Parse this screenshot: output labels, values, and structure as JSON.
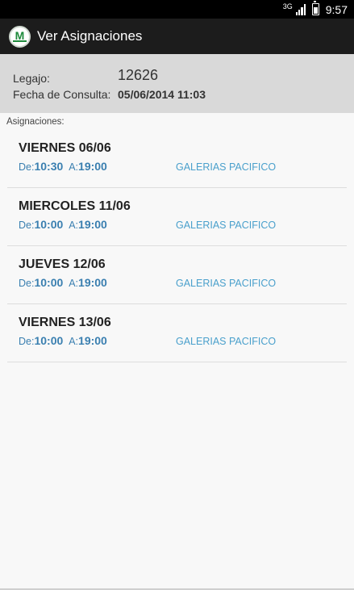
{
  "status_bar": {
    "network": "3G",
    "time": "9:57"
  },
  "action_bar": {
    "title": "Ver Asignaciones"
  },
  "header": {
    "legajo_label": "Legajo:",
    "legajo_value": "12626",
    "fecha_label": "Fecha de Consulta:",
    "fecha_value": "05/06/2014 11:03"
  },
  "section_label": "Asignaciones:",
  "assignments": [
    {
      "day": "VIERNES 06/06",
      "from_label": "De:",
      "from": "10:30",
      "to_label": "A:",
      "to": "19:00",
      "place": "GALERIAS PACIFICO"
    },
    {
      "day": "MIERCOLES 11/06",
      "from_label": "De:",
      "from": "10:00",
      "to_label": "A:",
      "to": "19:00",
      "place": "GALERIAS PACIFICO"
    },
    {
      "day": "JUEVES 12/06",
      "from_label": "De:",
      "from": "10:00",
      "to_label": "A:",
      "to": "19:00",
      "place": "GALERIAS PACIFICO"
    },
    {
      "day": "VIERNES 13/06",
      "from_label": "De:",
      "from": "10:00",
      "to_label": "A:",
      "to": "19:00",
      "place": "GALERIAS PACIFICO"
    }
  ]
}
